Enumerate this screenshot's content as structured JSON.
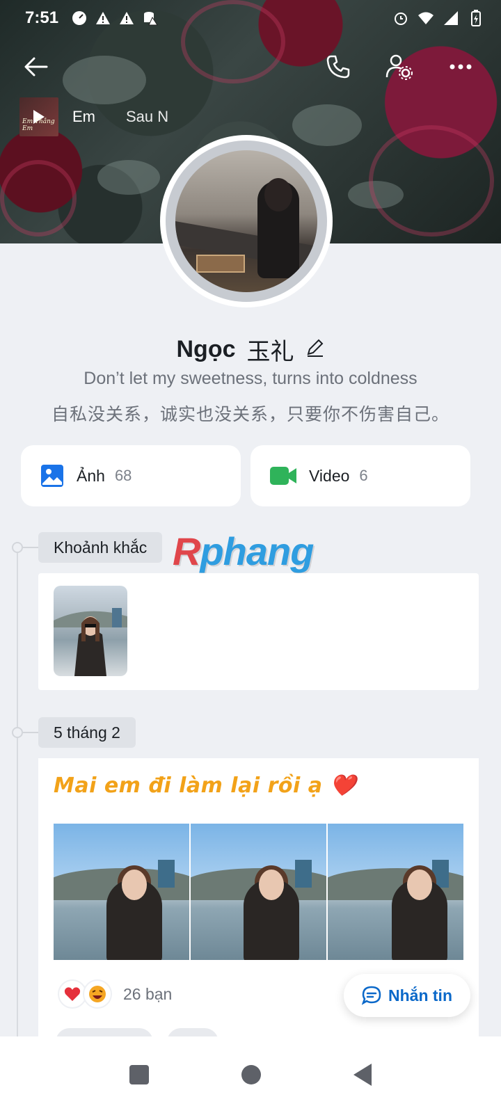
{
  "status_bar": {
    "time": "7:51"
  },
  "music": {
    "title": "Em",
    "artist": "Sau N",
    "thumb_caption": "Em Thắng Em"
  },
  "profile": {
    "name": "Ngọc",
    "name_cjk": "玉礼",
    "bio_line1": "Don’t let my sweetness, turns into coldness",
    "bio_line2": "自私没关系，诚实也没关系，只要你不伤害自己。"
  },
  "media": {
    "photos_label": "Ảnh",
    "photos_count": "68",
    "videos_label": "Video",
    "videos_count": "6"
  },
  "watermark": {
    "first": "R",
    "rest": "phang"
  },
  "timeline": {
    "moments_label": "Khoảnh khắc",
    "date_label": "5 tháng 2"
  },
  "post": {
    "text": "Mai em đi làm lại rồi ạ ❤️",
    "reaction_count": "26 bạn"
  },
  "message_button": {
    "label": "Nhắn tin"
  },
  "colors": {
    "accent_blue": "#0a68c9",
    "photo_blue": "#1a73e8",
    "video_green": "#2fb35a",
    "post_orange": "#f2a219"
  },
  "icons": [
    "back-arrow-icon",
    "phone-icon",
    "user-settings-icon",
    "more-icon",
    "edit-icon",
    "photo-icon",
    "video-icon",
    "heart-icon",
    "laugh-icon",
    "chat-icon"
  ]
}
